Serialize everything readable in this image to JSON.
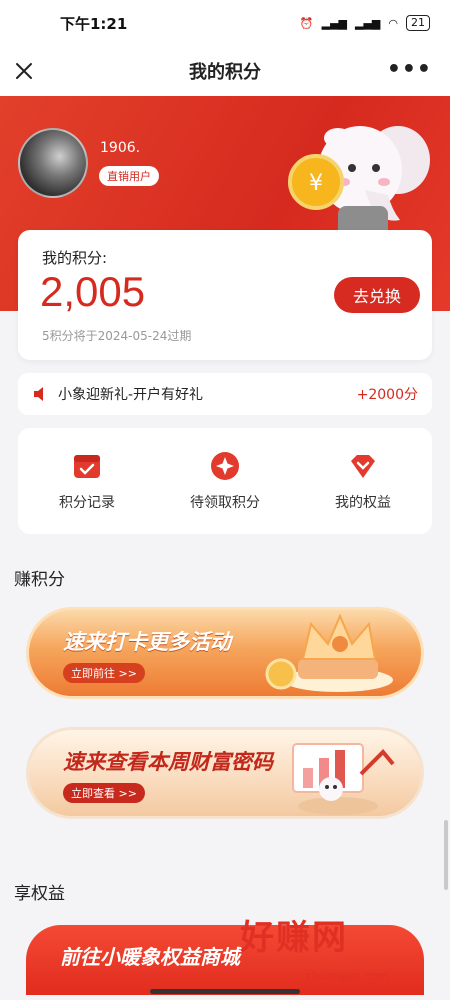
{
  "status": {
    "time": "下午1:21",
    "battery": "21"
  },
  "nav": {
    "title": "我的积分"
  },
  "user": {
    "name": "1906.",
    "tag": "直销用户"
  },
  "points": {
    "label": "我的积分:",
    "value": "2,005",
    "expire_note": "5积分将于2024-05-24过期",
    "exchange_label": "去兑换"
  },
  "notice": {
    "text": "小象迎新礼-开户有好礼",
    "bonus": "+2000分"
  },
  "actions": [
    {
      "label": "积分记录"
    },
    {
      "label": "待领取积分"
    },
    {
      "label": "我的权益"
    }
  ],
  "sections": {
    "earn": "赚积分",
    "benefits": "享权益"
  },
  "banners": [
    {
      "title": "速来打卡更多活动",
      "button": "立即前往 >>"
    },
    {
      "title": "速来查看本周财富密码",
      "button": "立即查看 >>"
    },
    {
      "title": "前往小暖象权益商城"
    }
  ],
  "watermark": {
    "main": "好赚网",
    "sub": "zhuanyes.com"
  },
  "colors": {
    "brand_red": "#d62a1f",
    "background": "#f4f4f6"
  }
}
